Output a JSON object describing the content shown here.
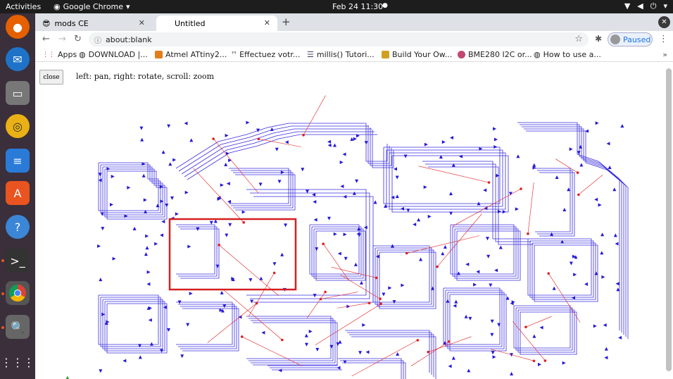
{
  "system_bar": {
    "activities": "Activities",
    "app_name": "Google Chrome",
    "clock": "Feb 24  11:30"
  },
  "tabs": [
    {
      "label": "mods CE"
    },
    {
      "label": "Untitled"
    }
  ],
  "address": {
    "url": "about:blank"
  },
  "profile": {
    "status": "Paused"
  },
  "bookmarks": [
    {
      "label": "Apps"
    },
    {
      "label": "DOWNLOAD |..."
    },
    {
      "label": "Atmel ATtiny2..."
    },
    {
      "label": "Effectuez votr..."
    },
    {
      "label": "millis() Tutori..."
    },
    {
      "label": "Build Your Ow..."
    },
    {
      "label": "BME280 I2C or..."
    },
    {
      "label": "How to use a..."
    }
  ],
  "page": {
    "close_label": "close",
    "hint": "left: pan, right: rotate, scroll: zoom"
  },
  "colors": {
    "trace": "#3a2ee0",
    "arrow": "#2418d8",
    "jump": "#e02020",
    "highlight": "#d42020"
  }
}
